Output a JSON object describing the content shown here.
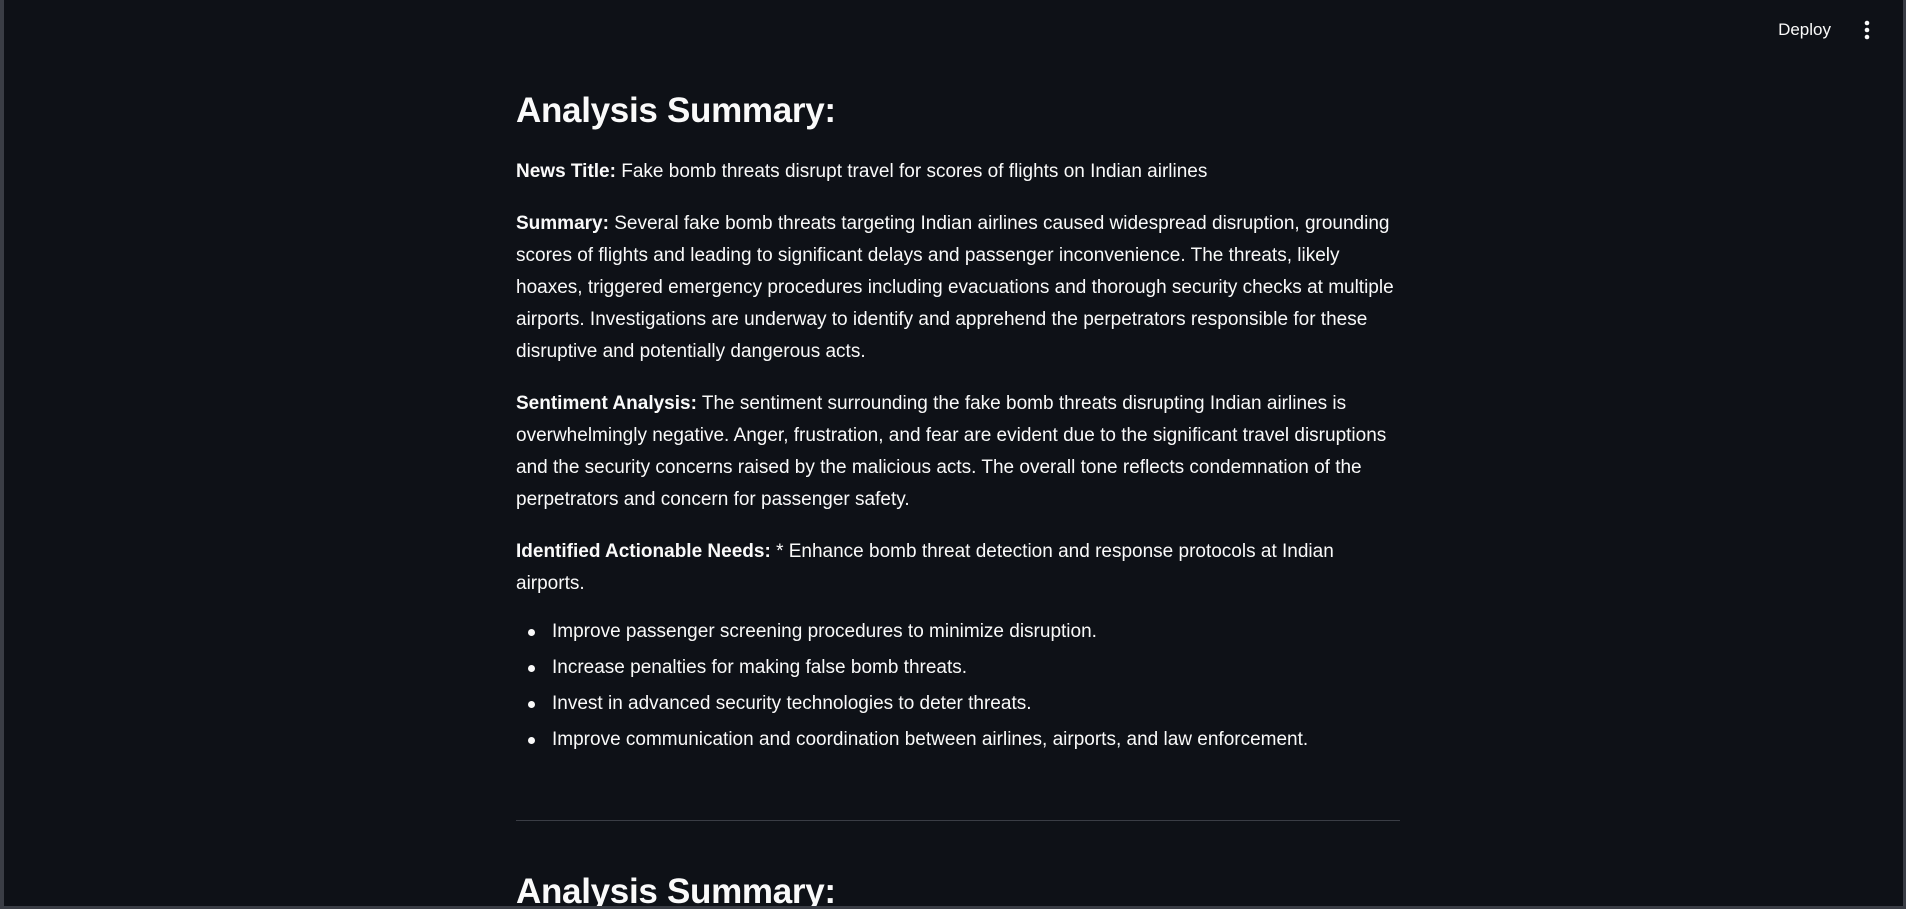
{
  "toolbar": {
    "deploy_label": "Deploy",
    "menu_icon": "vertical-ellipsis-icon"
  },
  "sections": [
    {
      "title": "Analysis Summary:",
      "news_title_label": "News Title:",
      "news_title_value": "Fake bomb threats disrupt travel for scores of flights on Indian airlines",
      "summary_label": "Summary:",
      "summary_value": "Several fake bomb threats targeting Indian airlines caused widespread disruption, grounding scores of flights and leading to significant delays and passenger inconvenience. The threats, likely hoaxes, triggered emergency procedures including evacuations and thorough security checks at multiple airports. Investigations are underway to identify and apprehend the perpetrators responsible for these disruptive and potentially dangerous acts.",
      "sentiment_label": "Sentiment Analysis:",
      "sentiment_value": "The sentiment surrounding the fake bomb threats disrupting Indian airlines is overwhelmingly negative. Anger, frustration, and fear are evident due to the significant travel disruptions and the security concerns raised by the malicious acts. The overall tone reflects condemnation of the perpetrators and concern for passenger safety.",
      "needs_label": "Identified Actionable Needs:",
      "needs_intro": "* Enhance bomb threat detection and response protocols at Indian airports.",
      "needs_items": [
        "Improve passenger screening procedures to minimize disruption.",
        "Increase penalties for making false bomb threats.",
        "Invest in advanced security technologies to deter threats.",
        "Improve communication and coordination between airlines, airports, and law enforcement."
      ]
    },
    {
      "title": "Analysis Summary:"
    }
  ]
}
